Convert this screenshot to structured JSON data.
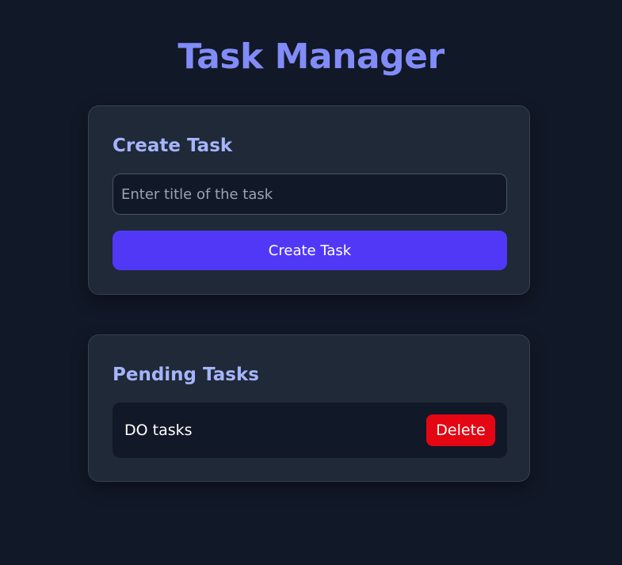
{
  "app": {
    "title": "Task Manager"
  },
  "create_section": {
    "heading": "Create Task",
    "input_placeholder": "Enter title of the task",
    "input_value": "",
    "button_label": "Create Task"
  },
  "pending_section": {
    "heading": "Pending Tasks",
    "tasks": [
      {
        "title": "DO tasks",
        "delete_label": "Delete"
      }
    ]
  },
  "colors": {
    "background": "#111827",
    "card": "#1f2937",
    "title_accent": "#818cf8",
    "heading_accent": "#a5b4fc",
    "primary_button": "#5138f7",
    "danger_button": "#e40613"
  }
}
